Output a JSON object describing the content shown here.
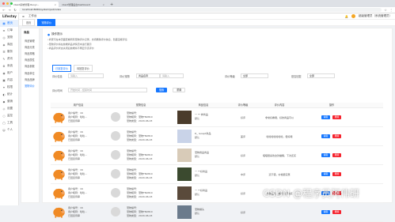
{
  "browser": {
    "tabs": [
      {
        "label": "client系统管理 Ruoyi...",
        "active": true
      },
      {
        "label": "client管理后台dashboard",
        "active": false
      }
    ],
    "url": "localhost:8080/system/pet/index"
  },
  "sidebar": {
    "brand": "Lifestay",
    "items": [
      {
        "icon": "▦",
        "label": "首页",
        "active": true
      },
      {
        "icon": "≡",
        "label": "订单"
      },
      {
        "icon": "◎",
        "label": "宠物"
      },
      {
        "icon": "◈",
        "label": "商品"
      },
      {
        "icon": "☰",
        "label": "服务"
      },
      {
        "icon": "✎",
        "label": "资讯"
      },
      {
        "icon": "⚙",
        "label": "系统"
      },
      {
        "icon": "◉",
        "label": "用户"
      },
      {
        "icon": "▣",
        "label": "内容"
      },
      {
        "icon": "✦",
        "label": "权限"
      },
      {
        "icon": "◐",
        "label": "统计"
      },
      {
        "icon": "◆",
        "label": "营销"
      },
      {
        "icon": "◇",
        "label": "设置"
      },
      {
        "icon": "○",
        "label": "监控"
      },
      {
        "icon": "▢",
        "label": "工具"
      },
      {
        "icon": "☺",
        "label": "个人"
      }
    ]
  },
  "topbar": {
    "collapse_icon": "≡",
    "breadcrumb": "工作台",
    "right_user": "超级管理员（系统管理员）",
    "notif_icon": "🔔"
  },
  "tags": [
    {
      "label": "首页",
      "active": false
    },
    {
      "label": "宠物评价",
      "active": true
    }
  ],
  "submenu": {
    "header": "商品",
    "items": [
      "商品管理",
      "商品分类",
      "商品规格",
      "商品属性",
      "商品参数",
      "商品单位",
      "商品品牌",
      "宠物评价"
    ],
    "active_index": 7
  },
  "tips": {
    "header": "操作提示",
    "lines": [
      "•商家可在本页面查看所有宠物评价记录，支持删除评价信息、隐藏违规评论",
      "•宠物评价将在前端商品详情页中进行展示",
      "•商品评价状态关闭后前端将不再显示该评价"
    ]
  },
  "subtabs": [
    {
      "label": "已回复评价",
      "active": true
    },
    {
      "label": "待回复评价",
      "active": false
    }
  ],
  "filters": {
    "keyword_label": "评价信息",
    "keyword_placeholder": "请输入",
    "goods_label": "评价宠物",
    "goods_value": "商品名称",
    "goods_placeholder": "请输入",
    "grade_label": "评价等级",
    "grade_value": "全部",
    "status_label": "是否回复",
    "status_value": "全部",
    "time_label": "评价时间",
    "time_placeholder": "开始时间 - 结束时间",
    "search_btn": "搜索",
    "reset_btn": "重置"
  },
  "table": {
    "headers": [
      "用户信息",
      "宠物信息",
      "商品信息",
      "评价等级",
      "评价内容",
      "操作"
    ],
    "rows": [
      {
        "user": [
          "用户编号：16",
          "用户昵称：哈哈...",
          "已回复待审"
        ],
        "pet": [
          "宠物编号：",
          "宠物昵称：宠物TN0810",
          "宠物类型：2020-06-03"
        ],
        "goods": [
          "一 ** 样商品",
          "默认"
        ],
        "grade": "好评",
        "content": "非常好看哦，好的商品可以",
        "color": "#4a3b2b"
      },
      {
        "user": [
          "用户编号：16",
          "用户昵称：哈哈...",
          "已回复待审"
        ],
        "pet": [
          "宠物编号：",
          "宠物昵称：宠物TN0810",
          "宠物类型：2020-06-03"
        ],
        "goods": [
          "D_ recept商品",
          "默认"
        ],
        "grade": "差评",
        "content": "哈哈哈哈哈哈哈，很好哦",
        "color": "#c9d3e8"
      },
      {
        "user": [
          "用户编号：16",
          "用户昵称：哈哈...",
          "已回复待审"
        ],
        "pet": [
          "宠物编号：",
          "宠物昵称：宠物TN0810",
          "宠物类型：2020-06-03"
        ],
        "goods": [
          "宠物用品商品",
          "默认"
        ],
        "grade": "好评",
        "content": "喵喵很喜欢这款猫粮，下次还买",
        "color": "#d8cbb8"
      },
      {
        "user": [
          "用户编号：16",
          "用户昵称：哈哈...",
          "已回复待审"
        ],
        "pet": [
          "宠物编号：",
          "宠物昵称：宠物TN0810",
          "宠物类型：2020-06-03"
        ],
        "goods": [
          "一 **好商品",
          "默认"
        ],
        "grade": "中评",
        "content": "还不错，价格很实惠",
        "color": "#3b4a2f"
      },
      {
        "user": [
          "用户编号：16",
          "用户昵称：哈哈...",
          "已回复待审"
        ],
        "pet": [
          "宠物编号：",
          "宠物昵称：宠物TN0810",
          "宠物类型：2020-06-03"
        ],
        "goods": [
          "一 **好商品",
          "默认"
        ],
        "grade": "好评",
        "content": "质量很好，推荐大家购买",
        "color": "#5a4a3b"
      },
      {
        "user": [
          "用户编号：16",
          "用户昵称：哈哈...",
          "已回复待审"
        ],
        "pet": [
          "宠物编号：",
          "宠物昵称：宠物TN0810",
          "宠物类型：2020-06-03"
        ],
        "goods": [
          "宠物罐头",
          "默认"
        ],
        "grade": "好评",
        "content": "",
        "color": "#6b7b8c"
      }
    ],
    "edit_label": "编辑",
    "delete_label": "删除"
  },
  "colors": {
    "primary": "#1677ff",
    "danger": "#f5222d",
    "pig": "#f08a24"
  },
  "watermark": "CSDN @程序员阿伟研"
}
